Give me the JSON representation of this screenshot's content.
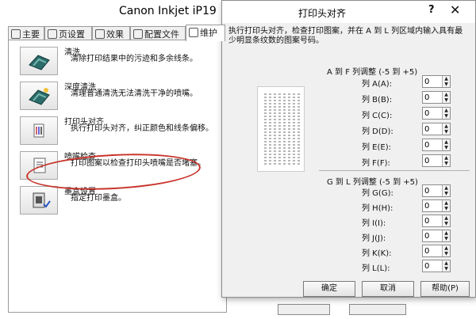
{
  "back_window": {
    "title": "Canon Inkjet iP19",
    "close_label": "✕",
    "tabs": [
      {
        "label": "主要"
      },
      {
        "label": "页设置"
      },
      {
        "label": "效果"
      },
      {
        "label": "配置文件"
      },
      {
        "label": "维护"
      }
    ],
    "maintenance_items": [
      {
        "title": "清洗",
        "desc": "清除打印结果中的污迹和多余线条。",
        "icon": "printhead-clean-icon"
      },
      {
        "title": "深度清洗",
        "desc": "清理普通清洗无法清洗干净的喷嘴。",
        "icon": "deep-clean-icon"
      },
      {
        "title": "打印头对齐",
        "desc": "执行打印头对齐，纠正颜色和线条偏移。",
        "icon": "head-alignment-icon"
      },
      {
        "title": "喷嘴检查",
        "desc": "打印图案以检查打印头喷嘴是否堵塞。",
        "icon": "nozzle-check-icon"
      },
      {
        "title": "墨盒设置",
        "desc": "指定打印墨盒。",
        "icon": "cartridge-settings-icon"
      }
    ]
  },
  "dialog": {
    "title": "打印头对齐",
    "help_glyph": "?",
    "close_glyph": "✕",
    "description": "执行打印头对齐，检查打印图案，并在 A 到 L 列区域内输入具有最少明显条纹数的图案号码。",
    "group_af": {
      "header": "A 到 F 列调整 (-5 到 +5)",
      "rows": [
        {
          "label": "列 A(A):",
          "value": "0"
        },
        {
          "label": "列 B(B):",
          "value": "0"
        },
        {
          "label": "列 C(C):",
          "value": "0"
        },
        {
          "label": "列 D(D):",
          "value": "0"
        },
        {
          "label": "列 E(E):",
          "value": "0"
        },
        {
          "label": "列 F(F):",
          "value": "0"
        }
      ]
    },
    "group_gl": {
      "header": "G 到 L 列调整 (-5 到 +5)",
      "rows": [
        {
          "label": "列 G(G):",
          "value": "0"
        },
        {
          "label": "列 H(H):",
          "value": "0"
        },
        {
          "label": "列 I(I):",
          "value": "0"
        },
        {
          "label": "列 J(J):",
          "value": "0"
        },
        {
          "label": "列 K(K):",
          "value": "0"
        },
        {
          "label": "列 L(L):",
          "value": "0"
        }
      ]
    },
    "buttons": {
      "ok": "确定",
      "cancel": "取消",
      "help": "帮助(P)"
    }
  },
  "colors": {
    "highlight_oval": "#c8332a"
  }
}
